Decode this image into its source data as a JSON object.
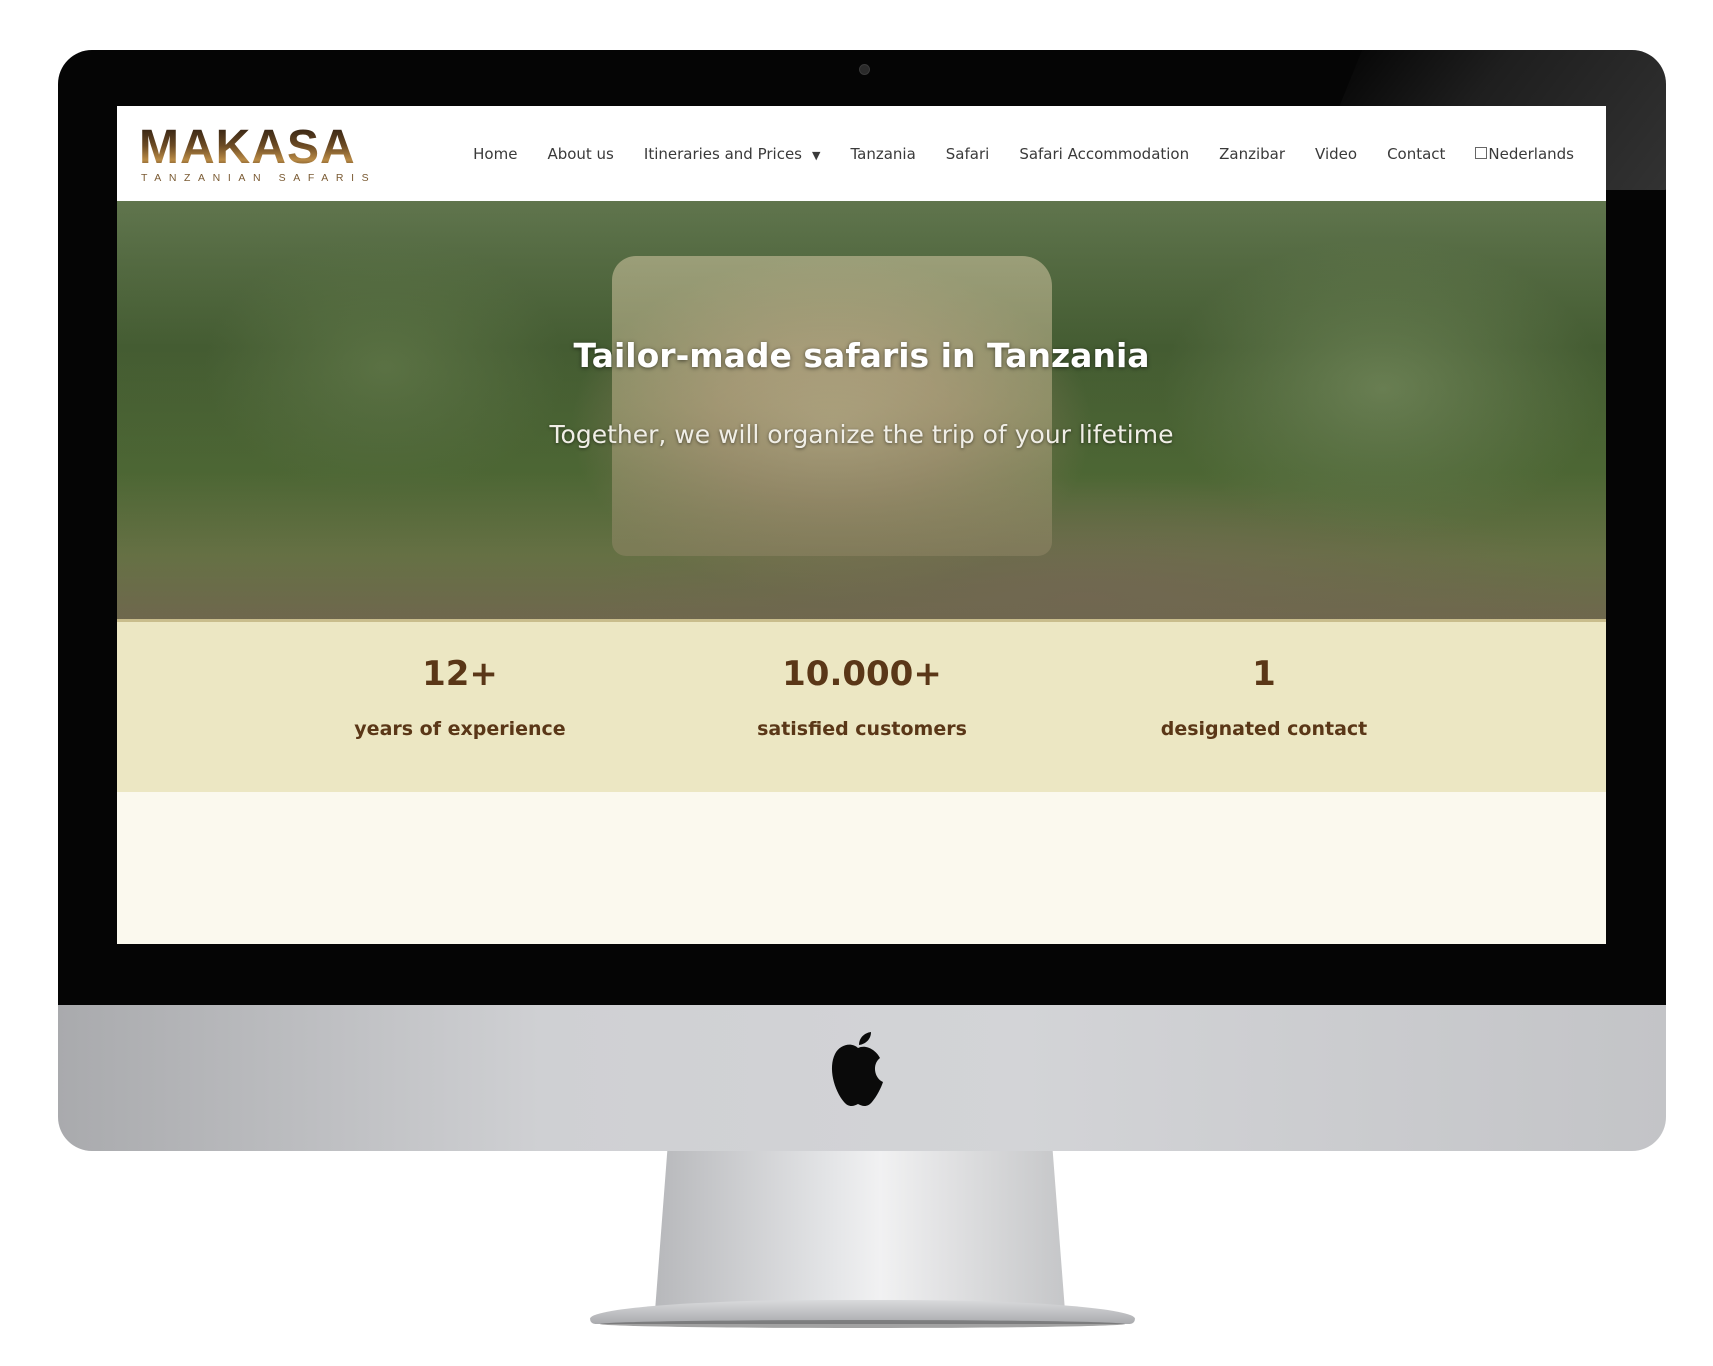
{
  "brand": {
    "name": "MAKASA",
    "tagline": "TANZANIAN SAFARIS"
  },
  "nav": {
    "items": [
      {
        "label": "Home"
      },
      {
        "label": "About us"
      },
      {
        "label": "Itineraries and Prices",
        "caret": "▼"
      },
      {
        "label": "Tanzania"
      },
      {
        "label": "Safari"
      },
      {
        "label": "Safari Accommodation"
      },
      {
        "label": "Zanzibar"
      },
      {
        "label": "Video"
      },
      {
        "label": "Contact"
      },
      {
        "label": "Nederlands"
      }
    ]
  },
  "hero": {
    "title": "Tailor-made safaris in Tanzania",
    "subtitle": "Together, we will organize the trip of your lifetime"
  },
  "stats": [
    {
      "number": "12+",
      "label": "years of experience"
    },
    {
      "number": "10.000+",
      "label": "satisfied customers"
    },
    {
      "number": "1",
      "label": "designated contact"
    }
  ],
  "colors": {
    "stats_background": "#ece7c3",
    "stats_text": "#5a3717",
    "page_background": "#fbf9ee"
  }
}
